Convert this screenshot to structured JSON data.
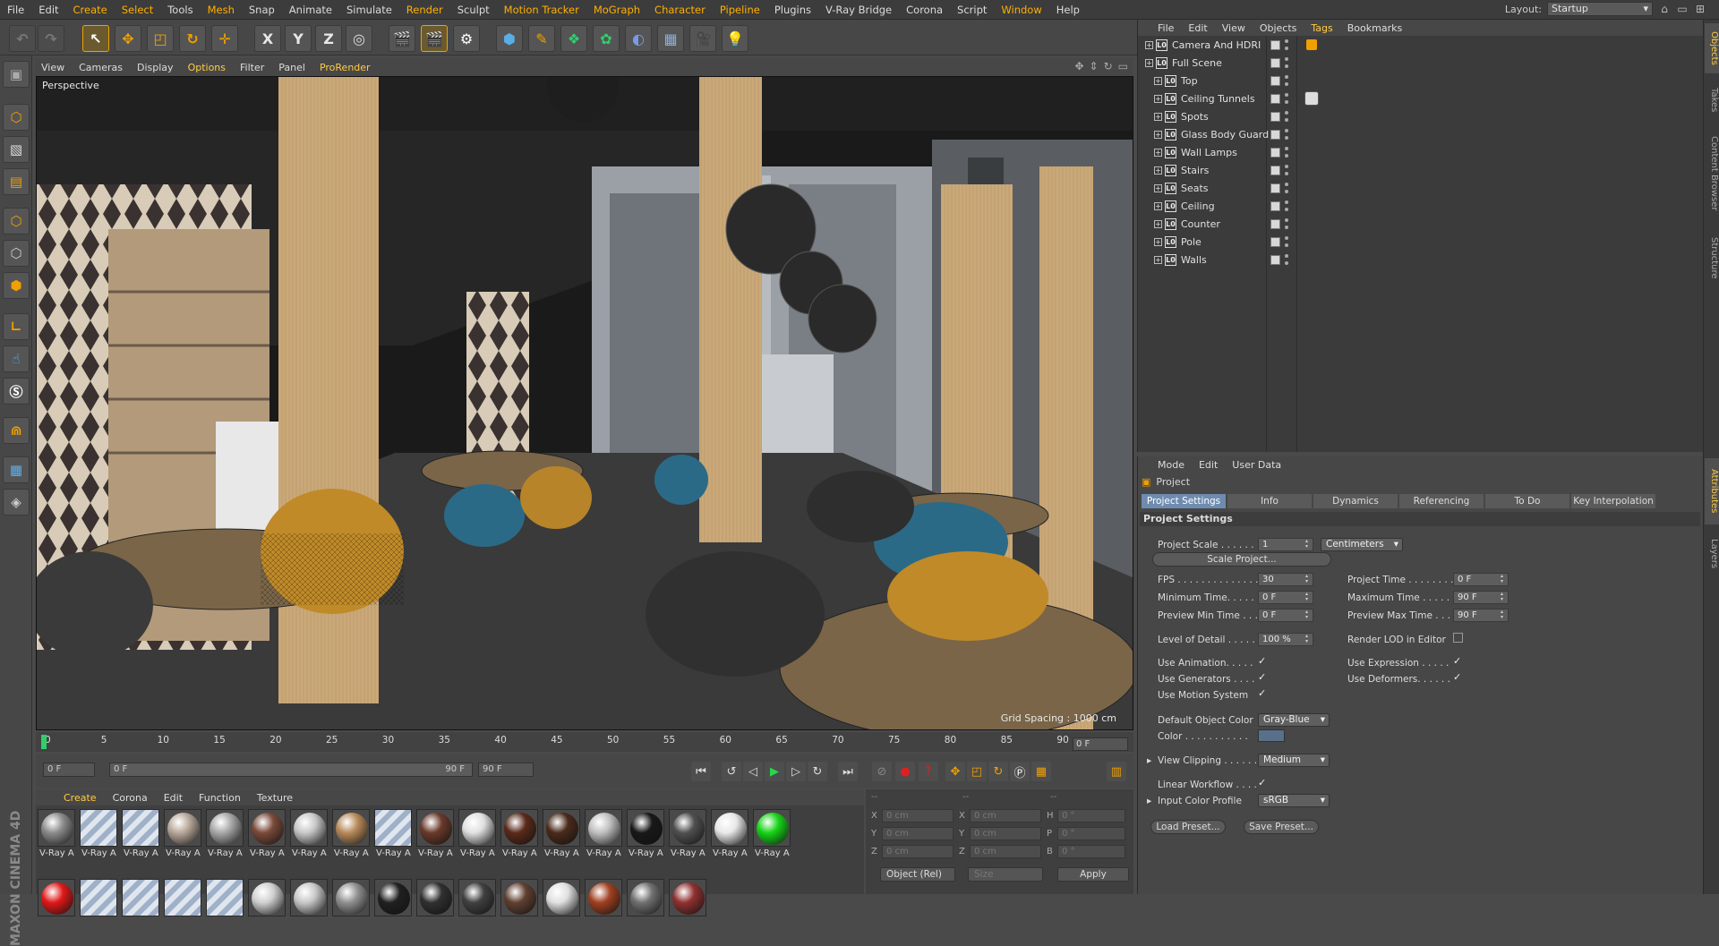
{
  "menu": [
    "File",
    "Edit",
    "Create",
    "Select",
    "Tools",
    "Mesh",
    "Snap",
    "Animate",
    "Simulate",
    "Render",
    "Sculpt",
    "Motion Tracker",
    "MoGraph",
    "Character",
    "Pipeline",
    "Plugins",
    "V-Ray Bridge",
    "Corona",
    "Script",
    "Window",
    "Help"
  ],
  "layout": {
    "label": "Layout:",
    "value": "Startup"
  },
  "toolbar": {
    "x": "X",
    "y": "Y",
    "z": "Z"
  },
  "viewport": {
    "menu": [
      "View",
      "Cameras",
      "Display",
      "Options",
      "Filter",
      "Panel",
      "ProRender"
    ],
    "label": "Perspective",
    "grid": "Grid Spacing : 1000 cm"
  },
  "timeline": {
    "ticks": [
      "0",
      "5",
      "10",
      "15",
      "20",
      "25",
      "30",
      "35",
      "40",
      "45",
      "50",
      "55",
      "60",
      "65",
      "70",
      "75",
      "80",
      "85",
      "90"
    ],
    "frame": "0 F"
  },
  "transport": {
    "start": "0 F",
    "slider_start": "0 F",
    "slider_end": "90 F",
    "end": "90 F"
  },
  "materials": {
    "tabs": [
      "Create",
      "Corona",
      "Edit",
      "Function",
      "Texture"
    ],
    "label": "V-Ray A",
    "row1": [
      "#8c8c8c",
      "stripe",
      "stripe",
      "#b8a89a",
      "#a8a8a8",
      "#7a4a3a",
      "#c8c8c8",
      "#b88a5a",
      "stripe",
      "#6a3a2a",
      "#e0e0e0",
      "#5a2a1a",
      "#4a2a1a",
      "#c0c0c0",
      "#181818",
      "#505050",
      "#e8e8e8",
      "#16d416"
    ],
    "row2": [
      "#e01818",
      "stripe",
      "stripe",
      "stripe",
      "stripe",
      "#d0d0d0",
      "#c8c8c8",
      "#909090",
      "#202020",
      "#303030",
      "#404040",
      "#604030",
      "#e0e0e0",
      "#a04020",
      "#707070",
      "#903030"
    ]
  },
  "coords": {
    "labels": [
      "X",
      "Y",
      "Z"
    ],
    "pos": [
      "0 cm",
      "0 cm",
      "0 cm"
    ],
    "size": [
      "0 cm",
      "0 cm",
      "0 cm"
    ],
    "rlabels": [
      "H",
      "P",
      "B"
    ],
    "rot": [
      "0 °",
      "0 °",
      "0 °"
    ],
    "mode": "Object (Rel)",
    "size_mode": "Size",
    "apply": "Apply",
    "dash": "--"
  },
  "objects": {
    "menu": [
      "File",
      "Edit",
      "View",
      "Objects",
      "Tags",
      "Bookmarks"
    ],
    "items": [
      {
        "name": "Camera And HDRI",
        "level": 0
      },
      {
        "name": "Full Scene",
        "level": 0
      },
      {
        "name": "Top",
        "level": 1
      },
      {
        "name": "Ceiling Tunnels",
        "level": 1
      },
      {
        "name": "Spots",
        "level": 1
      },
      {
        "name": "Glass Body Guard",
        "level": 1
      },
      {
        "name": "Wall Lamps",
        "level": 1
      },
      {
        "name": "Stairs",
        "level": 1
      },
      {
        "name": "Seats",
        "level": 1
      },
      {
        "name": "Ceiling",
        "level": 1
      },
      {
        "name": "Counter",
        "level": 1
      },
      {
        "name": "Pole",
        "level": 1
      },
      {
        "name": "Walls",
        "level": 1
      }
    ],
    "lo": "L0"
  },
  "attributes": {
    "menu": [
      "Mode",
      "Edit",
      "User Data"
    ],
    "title": "Project",
    "tabs": [
      "Project Settings",
      "Info",
      "Dynamics",
      "Referencing",
      "To Do",
      "Key Interpolation"
    ],
    "section": "Project Settings",
    "scale_label": "Project Scale . . . . . .",
    "scale_value": "1",
    "scale_unit": "Centimeters",
    "scale_btn": "Scale Project...",
    "fps_label": "FPS . . . . . . . . . . . . . . .",
    "fps": "30",
    "min_label": "Minimum Time. . . . .",
    "min": "0 F",
    "pmin_label": "Preview Min Time . . .",
    "pmin": "0 F",
    "ptime_label": "Project Time . . . . . . . .",
    "ptime": "0 F",
    "max_label": "Maximum Time . . . . .",
    "max": "90 F",
    "pmax_label": "Preview Max Time . . .",
    "pmax": "90 F",
    "lod_label": "Level of Detail . . . . .",
    "lod": "100 %",
    "rlod_label": "Render LOD in Editor",
    "anim_label": "Use Animation. . . . .",
    "gen_label": "Use Generators . . . .",
    "motion_label": "Use Motion System",
    "expr_label": "Use Expression . . . . .",
    "def_label": "Use Deformers. . . . . .",
    "doc_label": "Default Object Color",
    "doc": "Gray-Blue",
    "color_label": "Color . . . . . . . . . . .",
    "clip_label": "View Clipping . . . . . .",
    "clip": "Medium",
    "lw_label": "Linear Workflow . . . .",
    "icp_label": "Input Color Profile",
    "icp": "sRGB",
    "load": "Load Preset...",
    "save": "Save Preset...",
    "check": "✓"
  },
  "side_tabs": [
    "Objects",
    "Takes",
    "Content Browser",
    "Structure"
  ],
  "side_tabs2": [
    "Attributes",
    "Layers"
  ],
  "brand": "MAXON CINEMA 4D"
}
